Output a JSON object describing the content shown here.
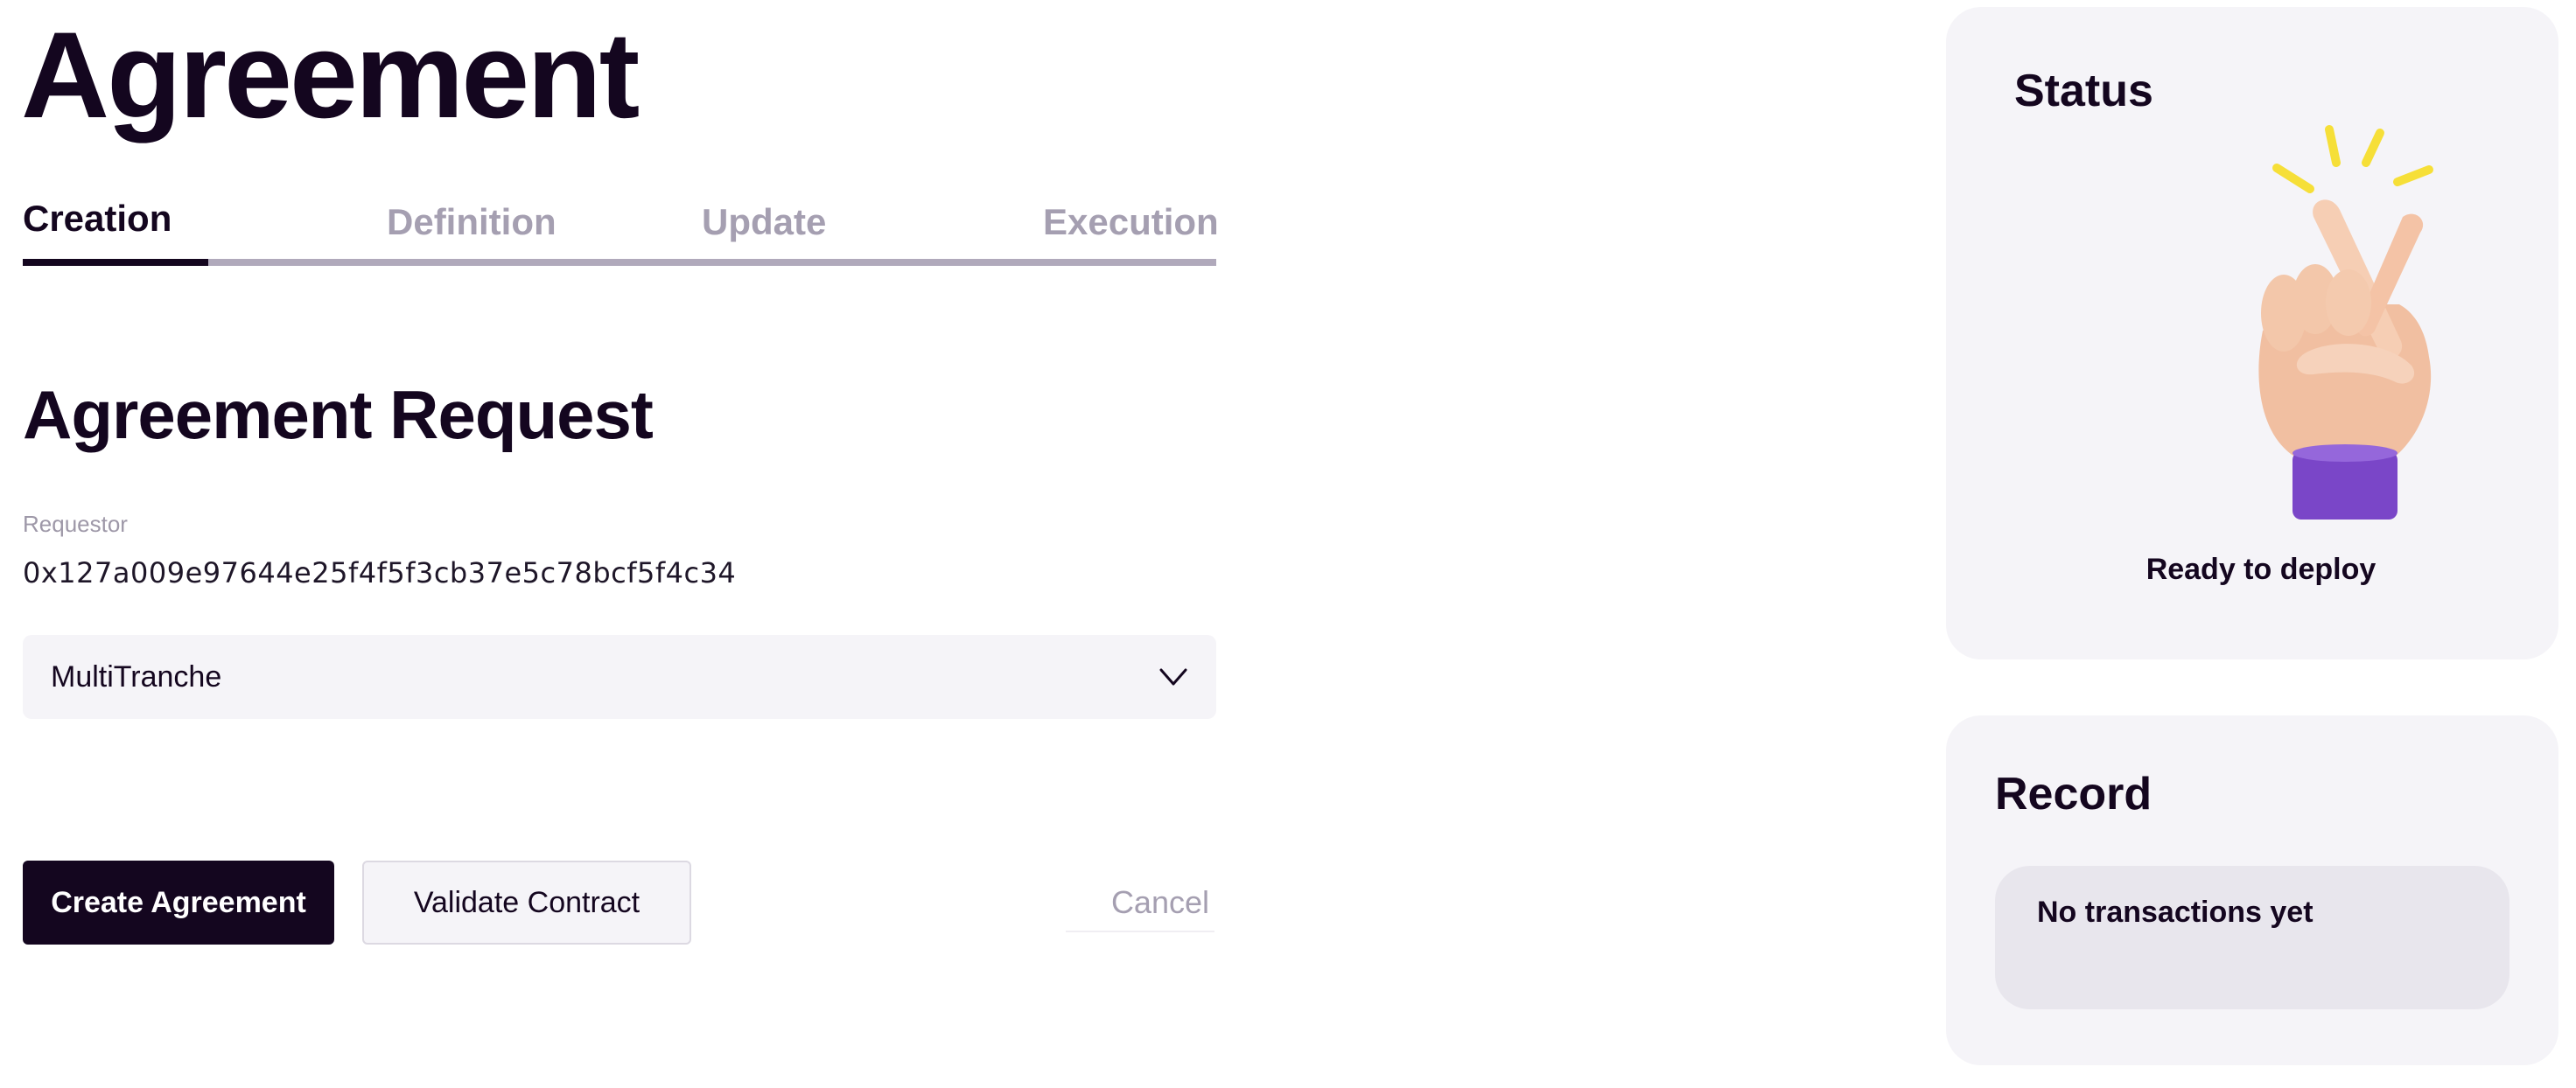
{
  "header": {
    "title": "Agreement"
  },
  "tabs": [
    {
      "label": "Creation",
      "active": true
    },
    {
      "label": "Definition",
      "active": false
    },
    {
      "label": "Update",
      "active": false
    },
    {
      "label": "Execution",
      "active": false
    }
  ],
  "form": {
    "section_title": "Agreement Request",
    "requestor_label": "Requestor",
    "requestor_value": "0x127a009e97644e25f4f5f3cb37e5c78bcf5f4c34",
    "agreement_type": "MultiTranche"
  },
  "actions": {
    "create_label": "Create Agreement",
    "validate_label": "Validate Contract",
    "cancel_label": "Cancel"
  },
  "status_card": {
    "title": "Status",
    "icon": "crossed-fingers-hand-illustration",
    "status_text": "Ready to deploy"
  },
  "record_card": {
    "title": "Record",
    "empty_text": "No transactions yet"
  },
  "colors": {
    "primary": "#14061f",
    "muted_text": "#a59fb1",
    "card_background": "#f5f4f8",
    "empty_box": "#e8e6ed",
    "accent_purple": "#7a46c8",
    "spark_yellow": "#f6df38"
  }
}
